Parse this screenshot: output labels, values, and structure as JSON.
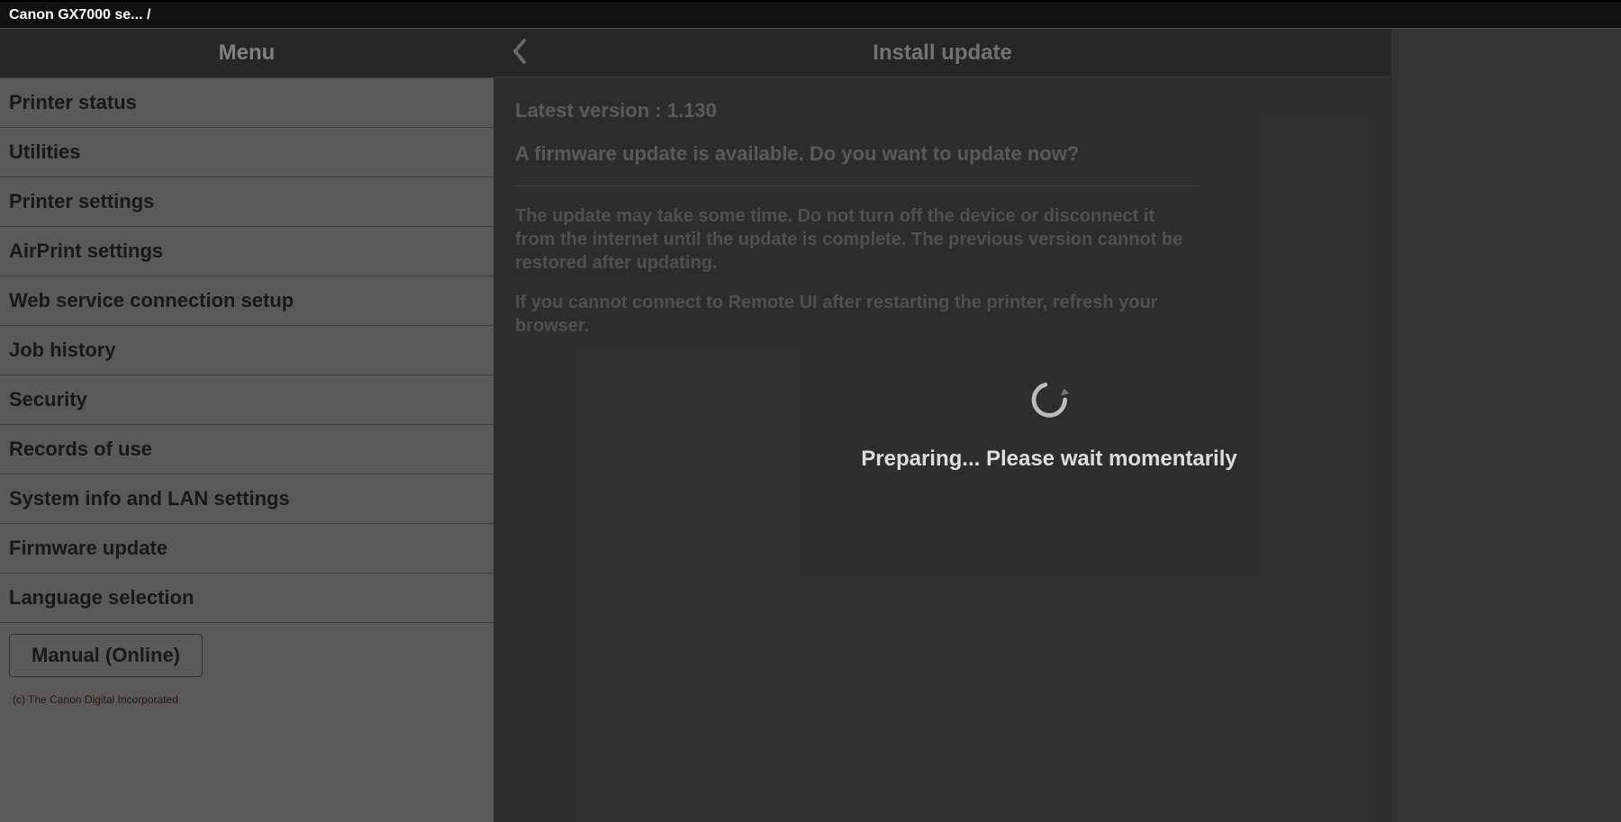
{
  "topbar": {
    "breadcrumb": "Canon GX7000 se... /"
  },
  "sidebar": {
    "header": "Menu",
    "items": [
      "Printer status",
      "Utilities",
      "Printer settings",
      "AirPrint settings",
      "Web service connection setup",
      "Job history",
      "Security",
      "Records of use",
      "System info and LAN settings",
      "Firmware update",
      "Language selection"
    ],
    "manual_button": "Manual (Online)",
    "footer": "(c) The Canon Digital Incorporated"
  },
  "main": {
    "title": "Install update",
    "latest_version_line": "Latest version : 1.130",
    "prompt": "A firmware update is available. Do you want to update now?",
    "warning": "The update may take some time. Do not turn off the device or disconnect it from the internet until the update is complete. The previous version cannot be restored after updating.",
    "note": "If you cannot connect to Remote UI after restarting the printer, refresh your browser."
  },
  "busy": {
    "message": "Preparing... Please wait momentarily"
  }
}
